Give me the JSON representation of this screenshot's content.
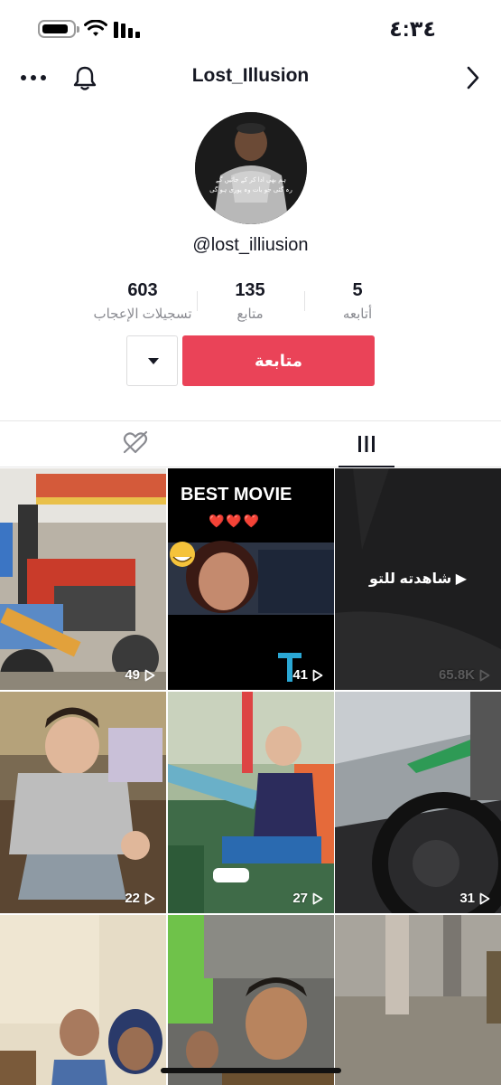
{
  "status_bar": {
    "time": "٤:٣٤"
  },
  "header": {
    "title": "Lost_Illusion"
  },
  "profile": {
    "username": "@lost_illiusion",
    "avatar_caption_line1": "ہم بھی ادا کر کے جائیں گے",
    "avatar_caption_line2": "رہ گئی جو بات وہ پوری ہو گی"
  },
  "stats": [
    {
      "value": "603",
      "label": "تسجيلات الإعجاب"
    },
    {
      "value": "135",
      "label": "متابع"
    },
    {
      "value": "5",
      "label": "أتابعه"
    }
  ],
  "actions": {
    "follow_label": "متابعة"
  },
  "tabs": [
    "liked",
    "videos"
  ],
  "grid": {
    "tiles": [
      {
        "count": "49"
      },
      {
        "count": "41",
        "title": "BEST MOVIE",
        "hearts": "❤️❤️❤️"
      },
      {
        "count": "65.8K",
        "overlay": "شاهدته للتو"
      },
      {
        "count": "22"
      },
      {
        "count": "27"
      },
      {
        "count": "31"
      },
      {
        "count": ""
      },
      {
        "count": ""
      },
      {
        "count": ""
      }
    ]
  },
  "colors": {
    "accent": "#ea4358",
    "text": "#161823",
    "muted": "#8a8b91"
  }
}
